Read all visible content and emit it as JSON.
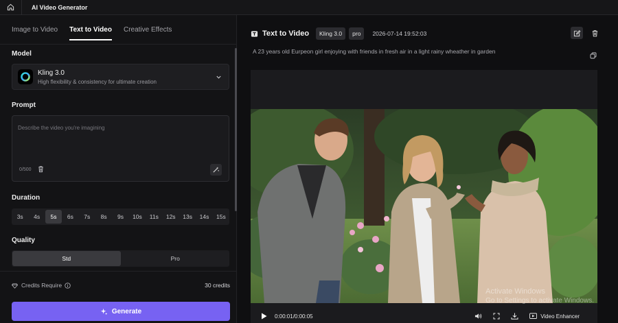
{
  "app": {
    "title": "AI Video Generator"
  },
  "tabs": [
    {
      "label": "Image to Video"
    },
    {
      "label": "Text to Video"
    },
    {
      "label": "Creative Effects"
    }
  ],
  "model": {
    "section_label": "Model",
    "name": "Kling 3.0",
    "description": "High flexibility & consistency for ultimate creation"
  },
  "prompt": {
    "section_label": "Prompt",
    "placeholder": "Describe the video you're imagining",
    "count": "0/500"
  },
  "duration": {
    "section_label": "Duration",
    "options": [
      "3s",
      "4s",
      "5s",
      "6s",
      "7s",
      "8s",
      "9s",
      "10s",
      "11s",
      "12s",
      "13s",
      "14s",
      "15s"
    ],
    "selected": "5s"
  },
  "quality": {
    "section_label": "Quality",
    "options": [
      "Std",
      "Pro"
    ],
    "selected": "Std"
  },
  "credits": {
    "label": "Credits Require",
    "value": "30 credits"
  },
  "generate": {
    "label": "Generate"
  },
  "result": {
    "title": "Text to Video",
    "model_badge": "Kling 3.0",
    "quality_badge": "pro",
    "date": "2026-07-14 19:52:03",
    "prompt_text": "A 23 years old Eurpeon girl enjoying with friends in fresh air in a light rainy wheather in garden"
  },
  "player": {
    "time": "0:00:01/0:00:05",
    "enhancer_label": "Video Enhancer"
  },
  "os_watermark": {
    "line1": "Activate Windows",
    "line2": "Go to Settings to activate Windows."
  },
  "colors": {
    "accent": "#7762f2",
    "background": "#101012"
  }
}
